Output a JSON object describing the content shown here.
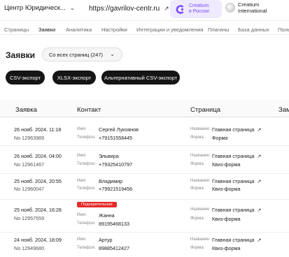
{
  "topbar": {
    "site_name": "Центр Юридическ...",
    "site_url": "https://gavrilov-centr.ru",
    "creatium_ru_line1": "Creatium",
    "creatium_ru_line2": "в России",
    "account_line1": "Creatium",
    "account_line2": "International"
  },
  "tabs": [
    "Страницы",
    "Заявки",
    "Аналитика",
    "Настройки",
    "Интеграции и уведомления",
    "Плагины",
    "База данных",
    "Польз"
  ],
  "page": {
    "title": "Заявки",
    "filter_value": "Со всех страниц (247)"
  },
  "export_buttons": [
    "CSV-экспорт",
    "XLSX-экспорт",
    "Альтернативный CSV-экспорт"
  ],
  "table": {
    "headers": [
      "Заявка",
      "Контакт",
      "Страница",
      "Зам"
    ],
    "labels": {
      "name": "Имя:",
      "phone": "Телефон:",
      "title": "Название:",
      "form": "Форма:"
    },
    "rows": [
      {
        "date": "26 нояб. 2024, 11:18",
        "number": "No 12963989",
        "badge": "",
        "name": "Сергей Лукоянов",
        "phone": "+79151558445",
        "page_title": "Главная страница",
        "form": "Форма"
      },
      {
        "date": "26 нояб. 2024, 04:00",
        "number": "No 12961467",
        "badge": "",
        "name": "Эльвира",
        "phone": "+79325410797",
        "page_title": "Главная страница",
        "form": "Квиз-форма"
      },
      {
        "date": "25 нояб. 2024, 20:55",
        "number": "No 12960047",
        "badge": "",
        "name": "Владимир",
        "phone": "+79921519456",
        "page_title": "Главная страница",
        "form": "Квиз-форма"
      },
      {
        "date": "25 нояб. 2024, 16:28",
        "number": "No 12957559",
        "badge": "Подозрительная",
        "name": "Жанна",
        "phone": "89195468133",
        "page_title": "Главная страница",
        "form": "Квиз-форма"
      },
      {
        "date": "24 нояб. 2024, 18:09",
        "number": "No 12949680",
        "badge": "",
        "name": "Артур",
        "phone": "89885412427",
        "page_title": "Главная страница",
        "form": "Квиз-форма"
      }
    ]
  },
  "colors": {
    "accent": "#7a4bff",
    "danger": "#e42a2a",
    "button_bg": "#151515"
  }
}
